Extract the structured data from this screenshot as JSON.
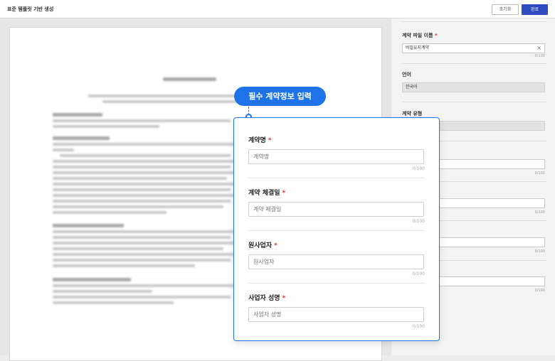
{
  "header": {
    "title": "표준 템플릿 기반 생성",
    "reset_label": "초기화",
    "done_label": "완료"
  },
  "side_form": {
    "file_name_label": "계약 파일 이름",
    "file_name_value": "비밀유지계약",
    "file_name_count": "0/100",
    "language_label": "언어",
    "language_value": "한국어",
    "type_label": "계약 유형",
    "extra_counts": [
      "0/100",
      "0/100",
      "0/100",
      "0/100"
    ]
  },
  "callout": {
    "label": "필수 계약정보 입력"
  },
  "required_form": {
    "fields": [
      {
        "label": "계약명",
        "placeholder": "계약명",
        "count": "0/100"
      },
      {
        "label": "계약 체결일",
        "placeholder": "계약 체결일",
        "count": "0/100"
      },
      {
        "label": "원사업자",
        "placeholder": "원사업자",
        "count": "0/100"
      },
      {
        "label": "사업자 성명",
        "placeholder": "사업자 성명",
        "count": "0/100"
      }
    ]
  }
}
